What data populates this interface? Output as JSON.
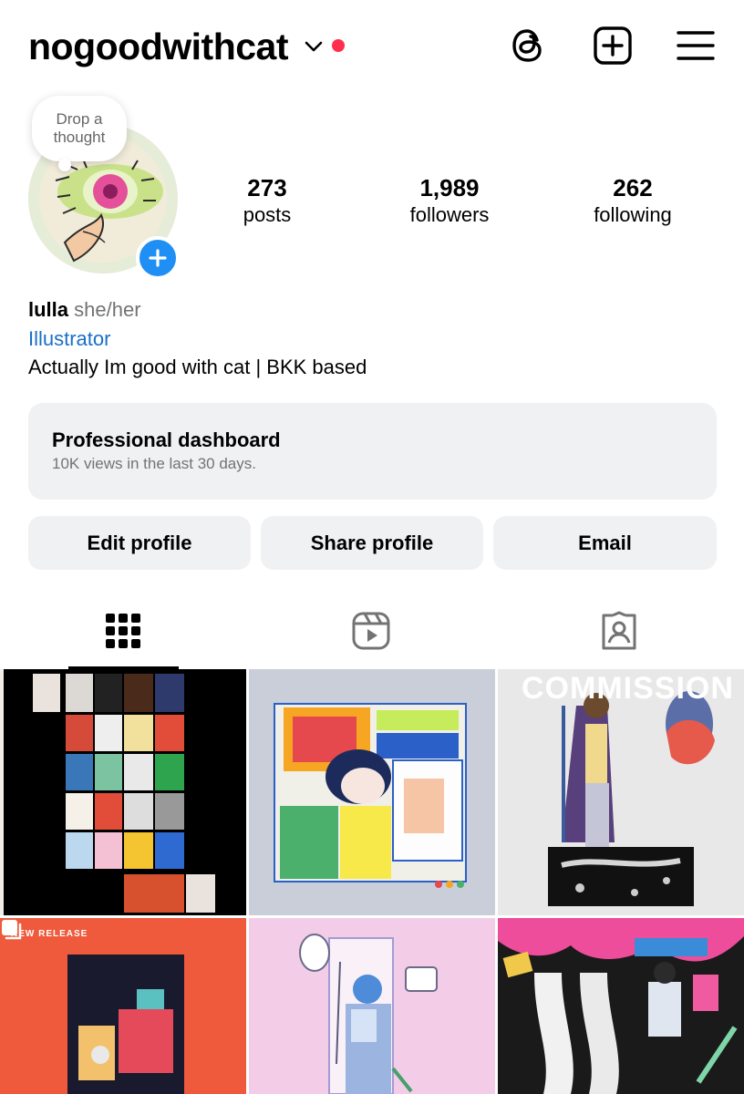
{
  "header": {
    "username": "nogoodwithcat",
    "icons": [
      "chevron-down-icon",
      "threads-icon",
      "create-icon",
      "menu-icon"
    ]
  },
  "profile": {
    "note": "Drop a thought",
    "stats": [
      {
        "value": "273",
        "label": "posts"
      },
      {
        "value": "1,989",
        "label": "followers"
      },
      {
        "value": "262",
        "label": "following"
      }
    ],
    "name": "lulla",
    "pronouns": "she/her",
    "category": "Illustrator",
    "bio": "Actually Im good with cat | BKK based"
  },
  "dashboard": {
    "title": "Professional dashboard",
    "subtitle": "10K views in the last 30 days."
  },
  "buttons": {
    "edit": "Edit profile",
    "share": "Share profile",
    "email": "Email"
  },
  "tabs": [
    "grid-icon",
    "reels-icon",
    "tagged-icon"
  ],
  "posts": {
    "commission_text": "COMMISSION",
    "new_release_text": "NEW RELEASE"
  },
  "colors": {
    "accent_blue": "#1f8ff5",
    "link_blue": "#1a6fc8",
    "notification_red": "#ff2e4c",
    "button_bg": "#f0f1f3"
  }
}
